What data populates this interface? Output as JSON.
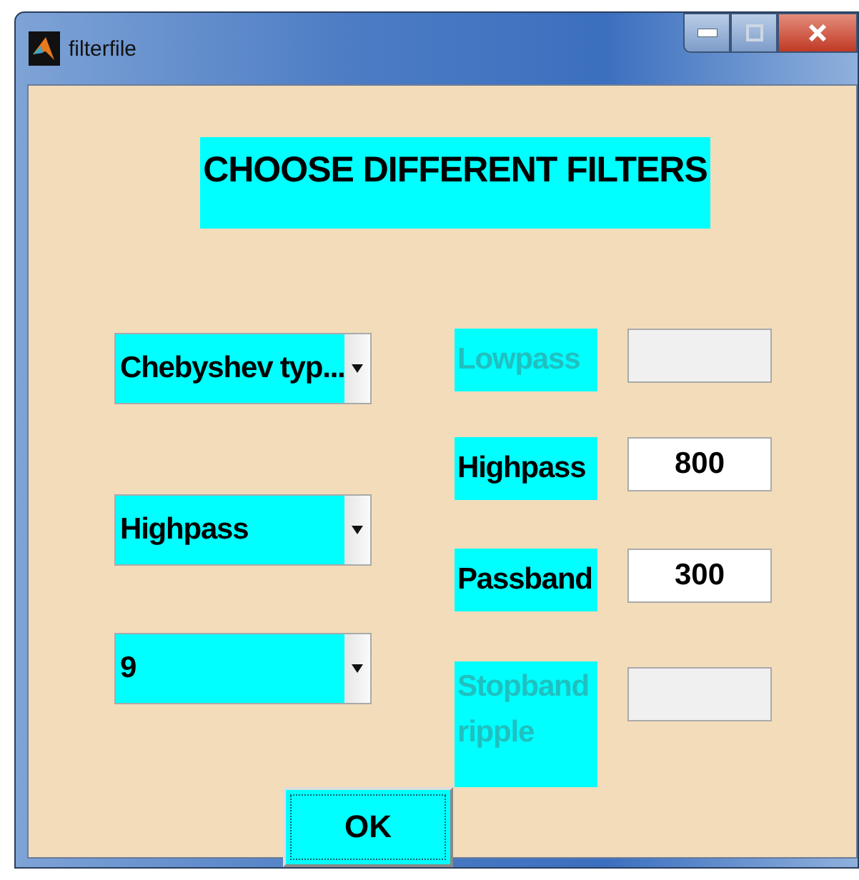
{
  "window": {
    "title": "filterfile"
  },
  "heading": "CHOOSE DIFFERENT FILTERS",
  "dropdowns": [
    {
      "value": "Chebyshev typ..."
    },
    {
      "value": "Highpass"
    },
    {
      "value": "9"
    }
  ],
  "parameters": [
    {
      "label": "Lowpass",
      "enabled": false
    },
    {
      "label": "Highpass",
      "value": "800",
      "enabled": true
    },
    {
      "label": "Passband",
      "value": "300",
      "enabled": true
    },
    {
      "label": "Stopband ripple",
      "enabled": false
    }
  ],
  "ok_button": {
    "label": "OK"
  }
}
